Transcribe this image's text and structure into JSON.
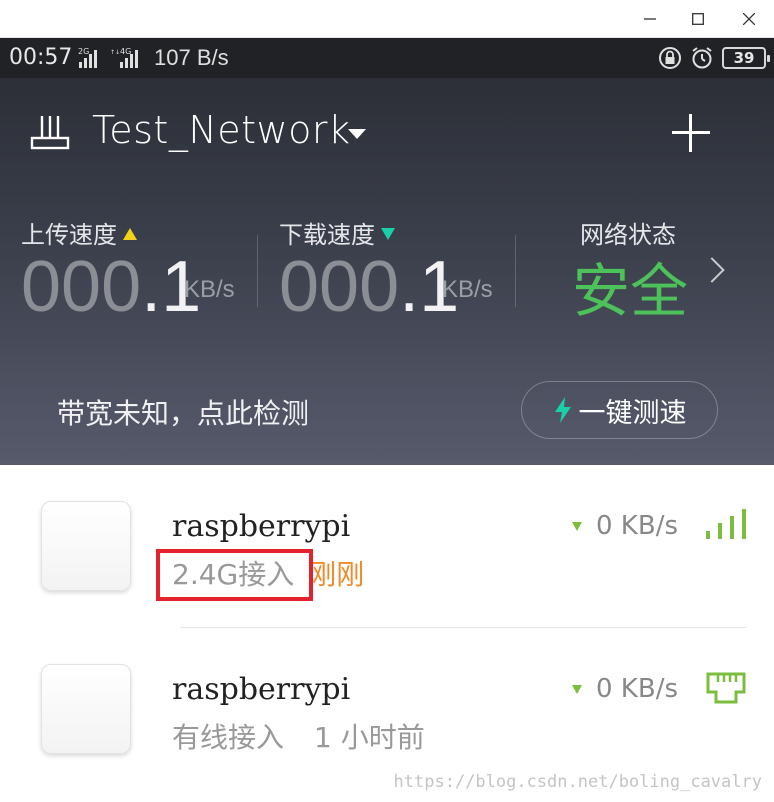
{
  "window": {
    "minimize_glyph": "—",
    "maximize_glyph": "☐",
    "close_glyph": "✕"
  },
  "status_bar": {
    "time": "00:57",
    "signal_1": "2G",
    "signal_2": "4G",
    "net_speed": "107 B/s",
    "battery": "39"
  },
  "header": {
    "network_name": "Test_Network",
    "upload_label": "上传速度",
    "download_label": "下载速度",
    "upload_value_lead": "000",
    "upload_value_tail": ".1",
    "download_value_lead": "000",
    "download_value_tail": ".1",
    "speed_unit": "KB/s",
    "status_label": "网络状态",
    "status_value": "安全",
    "bandwidth_text": "带宽未知，点此检测",
    "speedtest_label": "一键测速"
  },
  "colors": {
    "status_safe": "#4dc25a",
    "upload_arrow": "#f2d21a",
    "download_arrow": "#19d0a8",
    "time_orange": "#f08a26",
    "highlight_red": "#e3222c"
  },
  "devices": [
    {
      "name": "raspberrypi",
      "connection": "2.4G接入",
      "time": "刚刚",
      "rate": "0 KB/s",
      "link_icon": "wifi-signal-icon"
    },
    {
      "name": "raspberrypi",
      "connection": "有线接入",
      "time": "1 小时前",
      "rate": "0 KB/s",
      "link_icon": "ethernet-port-icon"
    }
  ],
  "watermark": "https://blog.csdn.net/boling_cavalry"
}
